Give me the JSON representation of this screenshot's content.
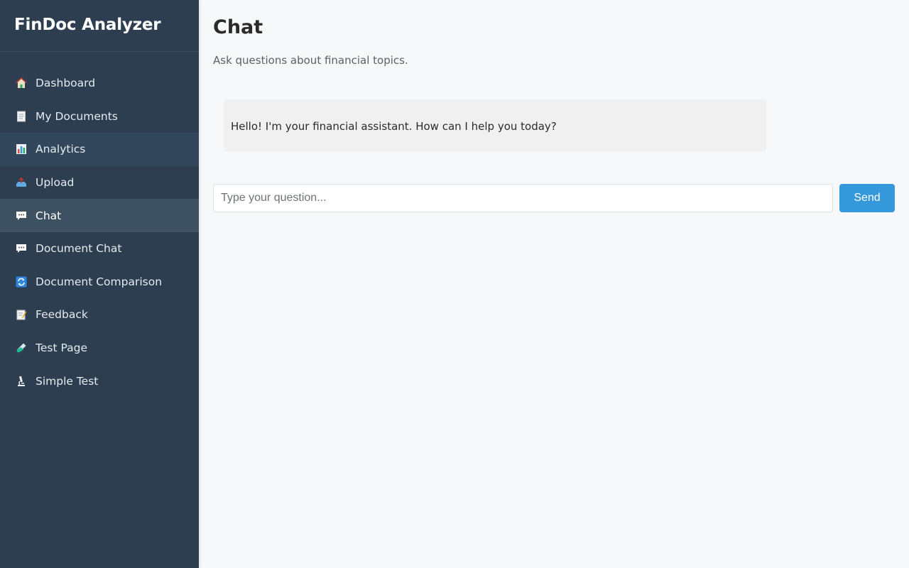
{
  "app": {
    "brand": "FinDoc Analyzer"
  },
  "sidebar": {
    "items": [
      {
        "label": "Dashboard",
        "icon": "house-icon"
      },
      {
        "label": "My Documents",
        "icon": "document-icon"
      },
      {
        "label": "Analytics",
        "icon": "bar-chart-icon"
      },
      {
        "label": "Upload",
        "icon": "upload-icon"
      },
      {
        "label": "Chat",
        "icon": "speech-bubble-icon",
        "active": true
      },
      {
        "label": "Document Chat",
        "icon": "speech-bubble-icon"
      },
      {
        "label": "Document Comparison",
        "icon": "refresh-icon"
      },
      {
        "label": "Feedback",
        "icon": "memo-icon"
      },
      {
        "label": "Test Page",
        "icon": "test-tube-icon"
      },
      {
        "label": "Simple Test",
        "icon": "microscope-icon"
      }
    ]
  },
  "main": {
    "title": "Chat",
    "subtitle": "Ask questions about financial topics.",
    "messages": [
      {
        "role": "assistant",
        "text": "Hello! I'm your financial assistant. How can I help you today?"
      }
    ],
    "input": {
      "placeholder": "Type your question...",
      "value": ""
    },
    "send_label": "Send"
  },
  "colors": {
    "sidebar_bg": "#2c3e50",
    "sidebar_active": "#3d5163",
    "accent": "#3498db",
    "page_bg": "#f7f8fa",
    "message_bg": "#f0f0f0"
  }
}
